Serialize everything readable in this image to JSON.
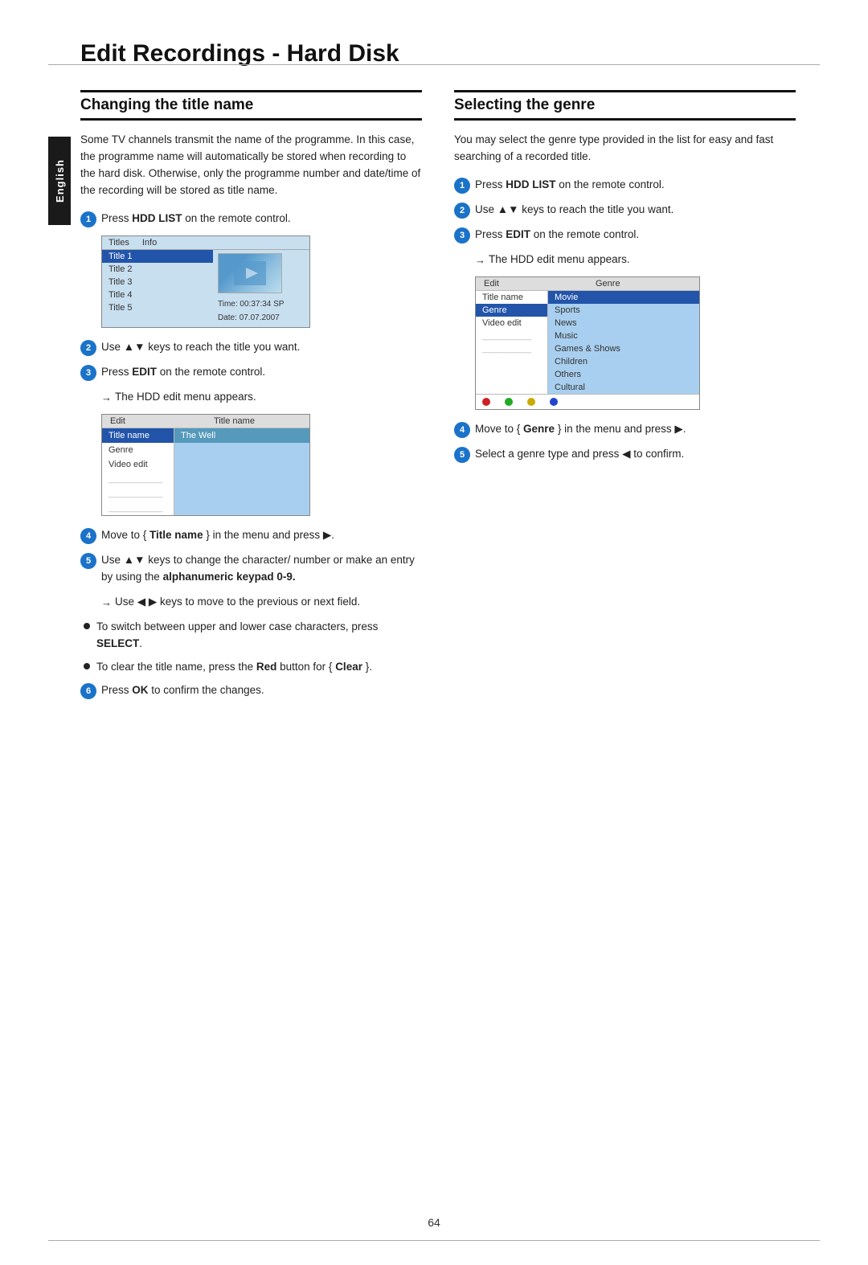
{
  "page": {
    "title": "Edit Recordings - Hard Disk",
    "number": "64",
    "english_tab": "English"
  },
  "left_section": {
    "heading": "Changing the title name",
    "intro": "Some TV channels transmit the name of the programme. In this case, the programme name will automatically be stored when recording to the hard disk. Otherwise, only the programme number and date/time of the recording will be stored as title name.",
    "steps": [
      {
        "num": "1",
        "text": "Press ",
        "bold": "HDD LIST",
        "text2": " on the remote control."
      },
      {
        "num": "2",
        "text": "Use ▲▼ keys to reach the title you want."
      },
      {
        "num": "3",
        "text": "Press ",
        "bold": "EDIT",
        "text2": " on the remote control.",
        "arrow": "The HDD edit menu appears."
      }
    ],
    "step4": "Move to { ",
    "step4_bold": "Title name",
    "step4_rest": " } in the menu and press ▶.",
    "step5": "Use ▲▼ keys to change the character/ number or make an entry by using the ",
    "step5_bold": "alphanumeric keypad 0-9.",
    "step5_arrow": "Use ◀ ▶ keys to move to the previous or next field.",
    "bullets": [
      {
        "text": "To switch between upper and lower case characters, press ",
        "bold": "SELECT",
        "text2": "."
      },
      {
        "text": "To clear the title name, press the ",
        "bold": "Red",
        "text2": " button for { ",
        "bold2": "Clear",
        "text3": " }."
      }
    ],
    "step6": "Press ",
    "step6_bold": "OK",
    "step6_rest": " to confirm the changes.",
    "titles_screen": {
      "header_left": "Titles",
      "header_right": "Info",
      "rows": [
        "Title 1",
        "Title 2",
        "Title 3",
        "Title 4",
        "Title 5"
      ],
      "highlighted_row": 0,
      "time_label": "Time:",
      "time_value": "00:37:34  SP",
      "date_label": "Date:",
      "date_value": "07.07.2007"
    },
    "edit_screen": {
      "header_left": "Edit",
      "header_right": "Title name",
      "rows": [
        "Title name",
        "Genre",
        "Video edit"
      ],
      "highlighted_row": 0,
      "value": "The Well"
    }
  },
  "right_section": {
    "heading": "Selecting the genre",
    "intro": "You may select the genre type provided in the list for easy and fast searching of a recorded title.",
    "steps": [
      {
        "num": "1",
        "text": "Press ",
        "bold": "HDD LIST",
        "text2": " on the remote control."
      },
      {
        "num": "2",
        "text": "Use ▲▼ keys to reach the title you want."
      },
      {
        "num": "3",
        "text": "Press ",
        "bold": "EDIT",
        "text2": " on the remote control.",
        "arrow": "The HDD edit menu appears."
      },
      {
        "num": "4",
        "text": "Move to { ",
        "bold": "Genre",
        "text2": " } in the menu and press ▶."
      },
      {
        "num": "5",
        "text": "Select a genre type and press ◀ to confirm."
      }
    ],
    "genre_screen": {
      "header_left": "Edit",
      "header_right": "Genre",
      "left_rows": [
        "Title name",
        "Genre",
        "Video edit"
      ],
      "highlighted_left": 1,
      "right_rows": [
        "Movie",
        "Sports",
        "News",
        "Music",
        "Games & Shows",
        "Children",
        "Others",
        "Cultural"
      ],
      "highlighted_right": 0,
      "dots": [
        {
          "color": "#cc2222"
        },
        {
          "color": "#22aa22"
        },
        {
          "color": "#ccaa00"
        },
        {
          "color": "#2244cc"
        }
      ]
    }
  }
}
